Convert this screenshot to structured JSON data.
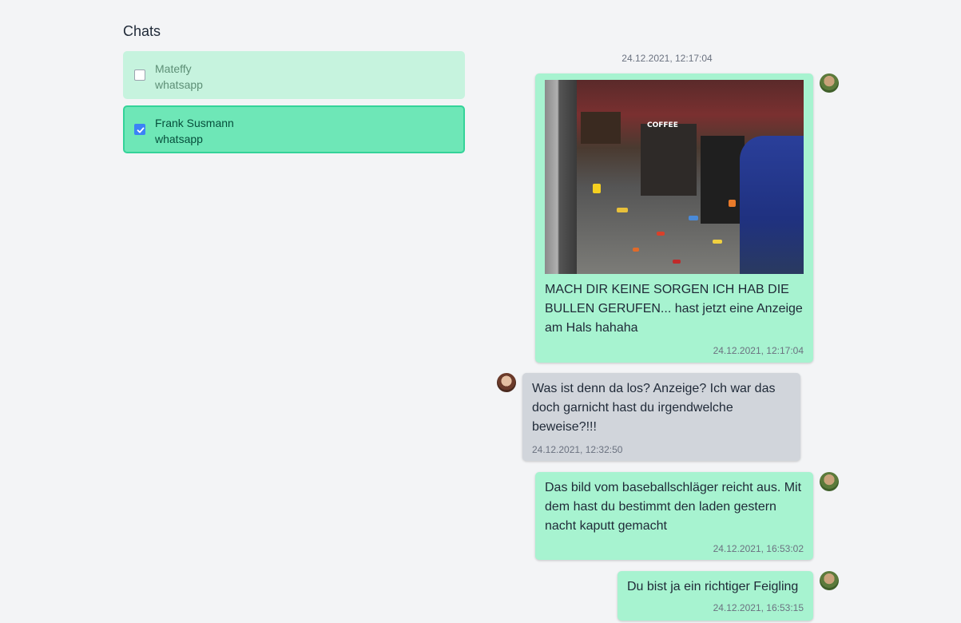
{
  "sidebar": {
    "title": "Chats",
    "chats": [
      {
        "name": "Mateffy",
        "source": "whatsapp",
        "selected": false
      },
      {
        "name": "Frank Susmann",
        "source": "whatsapp",
        "selected": true
      }
    ]
  },
  "conversation": {
    "date_separator": "24.12.2021, 12:17:04",
    "messages": [
      {
        "direction": "outgoing",
        "has_image": true,
        "text": "MACH DIR KEINE SORGEN ICH HAB DIE BULLEN GERUFEN... hast jetzt eine Anzeige am Hals hahaha",
        "time": "24.12.2021, 12:17:04"
      },
      {
        "direction": "incoming",
        "text": "Was ist denn da los? Anzeige? Ich war das doch garnicht hast du irgendwelche beweise?!!!",
        "time": "24.12.2021, 12:32:50"
      },
      {
        "direction": "outgoing",
        "text": "Das bild vom baseballschläger reicht aus. Mit dem hast du bestimmt den laden gestern nacht kaputt gemacht",
        "time": "24.12.2021, 16:53:02"
      },
      {
        "direction": "outgoing",
        "text": "Du bist ja ein richtiger Feigling",
        "time": "24.12.2021, 16:53:15"
      }
    ],
    "photo_sign": "COFFEE"
  },
  "colors": {
    "outgoing_bubble": "#a7f3d0",
    "incoming_bubble": "#d1d5db",
    "selected_chat": "#6ee7b7",
    "unselected_chat": "#c6f3de",
    "checkbox_checked": "#3b82f6"
  }
}
